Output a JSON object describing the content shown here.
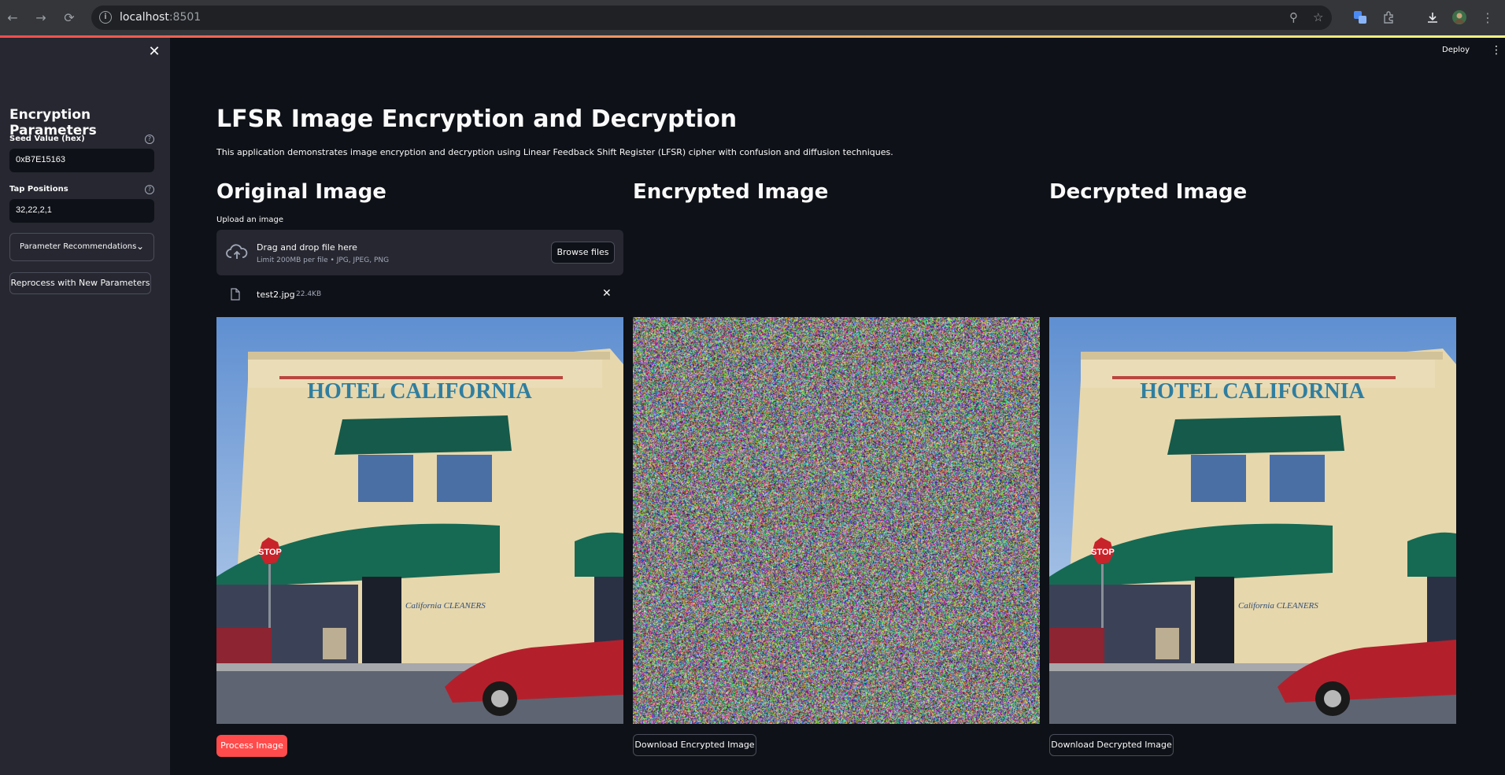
{
  "browser": {
    "url_host": "localhost",
    "url_port": ":8501"
  },
  "topbar": {
    "deploy_label": "Deploy"
  },
  "sidebar": {
    "title": "Encryption Parameters",
    "seed_label": "Seed Value (hex)",
    "seed_value": "0xB7E15163",
    "tap_label": "Tap Positions",
    "tap_value": "32,22,2,1",
    "expander_label": "Parameter Recommendations",
    "reprocess_label": "Reprocess with New Parameters"
  },
  "main": {
    "title": "LFSR Image Encryption and Decryption",
    "description": "This application demonstrates image encryption and decryption using Linear Feedback Shift Register (LFSR) cipher with confusion and diffusion techniques.",
    "col_original": "Original Image",
    "col_encrypted": "Encrypted Image",
    "col_decrypted": "Decrypted Image",
    "upload_label": "Upload an image",
    "dropzone_title": "Drag and drop file here",
    "dropzone_sub": "Limit 200MB per file • JPG, JPEG, PNG",
    "browse_label": "Browse files",
    "file_name": "test2.jpg",
    "file_size": "22.4KB",
    "process_label": "Process Image",
    "download_encrypted_label": "Download Encrypted Image",
    "download_decrypted_label": "Download Decrypted Image",
    "photo_sign_text": "HOTEL CALIFORNIA",
    "photo_cleaners_text": "California CLEANERS",
    "photo_stop_text": "STOP"
  },
  "colors": {
    "accent": "#ff4b4b",
    "background": "#0e1117",
    "sidebar": "#262730"
  }
}
